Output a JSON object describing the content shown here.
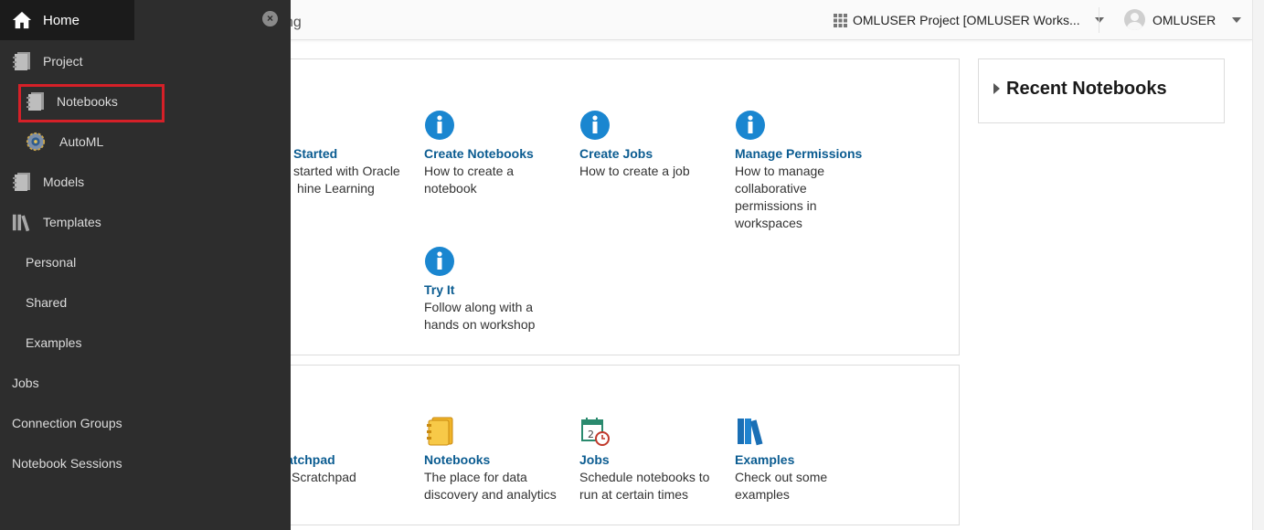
{
  "header": {
    "crumb_partial": "ng",
    "project_selector": "OMLUSER Project [OMLUSER Works...",
    "user_name": "OMLUSER"
  },
  "sidenav": {
    "close_symbol": "×",
    "items": [
      {
        "label": "Home",
        "icon": "home-icon"
      },
      {
        "label": "Project",
        "icon": "notebook-icon"
      },
      {
        "label": "Notebooks",
        "icon": "notebook-icon"
      },
      {
        "label": "AutoML",
        "icon": "automl-icon"
      },
      {
        "label": "Models",
        "icon": "notebook-icon"
      },
      {
        "label": "Templates",
        "icon": "library-icon"
      },
      {
        "label": "Personal"
      },
      {
        "label": "Shared"
      },
      {
        "label": "Examples"
      },
      {
        "label": "Jobs"
      },
      {
        "label": "Connection Groups"
      },
      {
        "label": "Notebook Sessions"
      }
    ]
  },
  "learn_cards": [
    {
      "title": "Started",
      "desc1": "started with Oracle",
      "desc2": "hine Learning",
      "icon": "info-icon"
    },
    {
      "title": "Create Notebooks",
      "desc1": "How to create a",
      "desc2": "notebook",
      "icon": "info-icon"
    },
    {
      "title": "Create Jobs",
      "desc1": "How to create a job",
      "icon": "info-icon"
    },
    {
      "title": "Manage Permissions",
      "desc1": "How to manage",
      "desc2": "collaborative",
      "desc3": "permissions in",
      "desc4": "workspaces",
      "icon": "info-icon"
    },
    {
      "title": "Try It",
      "desc1": "Follow along with a",
      "desc2": "hands on workshop",
      "icon": "info-icon"
    }
  ],
  "quick_cards": [
    {
      "title": "atchpad",
      "desc1": "Scratchpad",
      "icon": "scratchpad-icon"
    },
    {
      "title": "Notebooks",
      "desc1": "The place for data",
      "desc2": "discovery and analytics",
      "icon": "notebook-icon"
    },
    {
      "title": "Jobs",
      "desc1": "Schedule notebooks to",
      "desc2": "run at certain times",
      "icon": "calendar-clock-icon"
    },
    {
      "title": "Examples",
      "desc1": "Check out some",
      "desc2": "examples",
      "icon": "books-icon"
    }
  ],
  "recent": {
    "title": "Recent Notebooks"
  },
  "colors": {
    "sidebar_bg": "#2d2d2d",
    "link_blue": "#0b5c91",
    "info_blue": "#1a86d0",
    "highlight_red": "#d52028"
  }
}
